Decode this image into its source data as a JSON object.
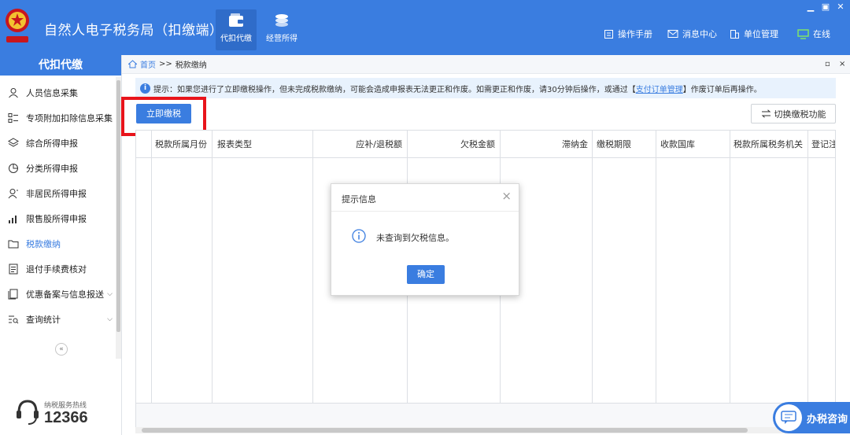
{
  "header": {
    "title": "自然人电子税务局（扣缴端）",
    "nav": [
      {
        "label": "代扣代缴",
        "icon": "wallet-icon",
        "active": true
      },
      {
        "label": "经营所得",
        "icon": "coins-icon",
        "active": false
      }
    ],
    "tools": [
      {
        "label": "操作手册",
        "icon": "manual-icon"
      },
      {
        "label": "消息中心",
        "icon": "mail-icon"
      },
      {
        "label": "单位管理",
        "icon": "building-icon"
      },
      {
        "label": "在线",
        "icon": "monitor-icon"
      }
    ],
    "accent": "#3a7de0"
  },
  "sidebar": {
    "title": "代扣代缴",
    "items": [
      {
        "label": "人员信息采集",
        "icon": "person-icon"
      },
      {
        "label": "专项附加扣除信息采集",
        "icon": "list-icon"
      },
      {
        "label": "综合所得申报",
        "icon": "layers-icon"
      },
      {
        "label": "分类所得申报",
        "icon": "pie-icon"
      },
      {
        "label": "非居民所得申报",
        "icon": "person-alt-icon"
      },
      {
        "label": "限售股所得申报",
        "icon": "bar-chart-icon"
      },
      {
        "label": "税款缴纳",
        "icon": "folder-icon"
      },
      {
        "label": "退付手续费核对",
        "icon": "document-icon"
      },
      {
        "label": "优惠备案与信息报送",
        "icon": "doc-stack-icon"
      },
      {
        "label": "查询统计",
        "icon": "search-list-icon"
      }
    ],
    "collapse": "«",
    "hotline_label": "纳税服务热线",
    "hotline_number": "12366"
  },
  "main": {
    "breadcrumb": {
      "home": "首页",
      "separator": ">>",
      "current": "税款缴纳"
    },
    "notice": {
      "text_before": "提示：如果您进行了立即缴税操作，但未完成税款缴纳，可能会造成申报表无法更正和作废。如需更正和作废，请30分钟后操作，或通过【",
      "link": "支付订单管理",
      "text_after": "】作废订单后再操作。"
    },
    "pay_button": "立即缴税",
    "switch_button": "切换缴税功能",
    "columns": [
      "税款所属月份",
      "报表类型",
      "应补/退税额",
      "欠税金额",
      "滞纳金",
      "缴税期限",
      "收款国库",
      "税款所属税务机关",
      "登记注"
    ]
  },
  "dialog": {
    "title": "提示信息",
    "close": "×",
    "message": "未查询到欠税信息。",
    "ok": "确定"
  },
  "consult": {
    "label": "办税咨询"
  }
}
